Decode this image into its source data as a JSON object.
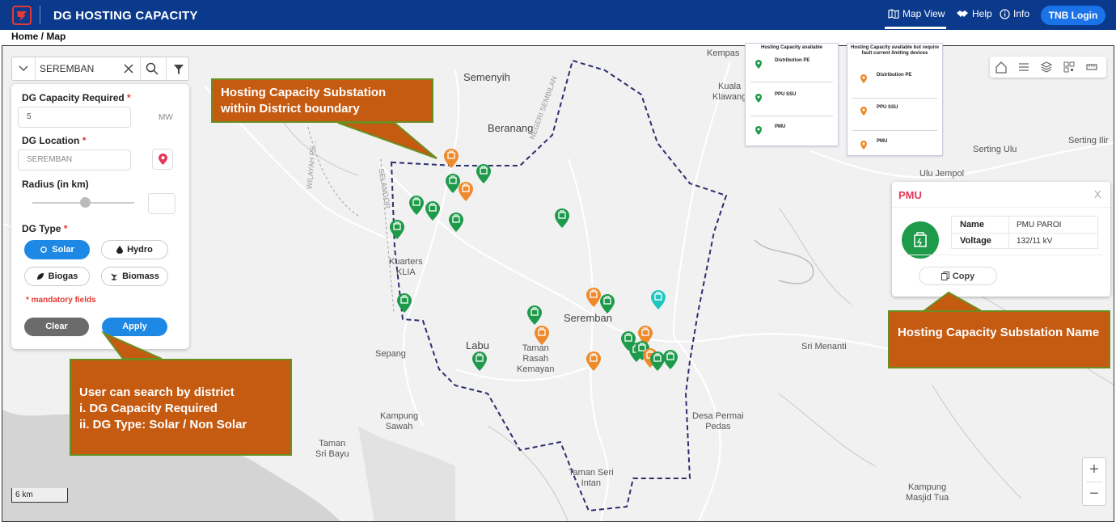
{
  "header": {
    "title": "DG HOSTING CAPACITY",
    "nav": {
      "map_view": "Map View",
      "help": "Help",
      "info": "Info",
      "login": "TNB Login"
    },
    "brand_color": "#0b3a8c"
  },
  "breadcrumb": "Home / Map",
  "search": {
    "value": "SEREMBAN"
  },
  "filter": {
    "capacity_label": "DG Capacity Required",
    "capacity_value": "5",
    "capacity_unit": "MW",
    "location_label": "DG Location",
    "location_value": "SEREMBAN",
    "radius_label": "Radius (in km)",
    "type_label": "DG Type",
    "required_mark": "*",
    "types": {
      "solar": "Solar",
      "hydro": "Hydro",
      "biogas": "Biogas",
      "biomass": "Biomass"
    },
    "mandatory_note": "* mandatory fields",
    "clear": "Clear",
    "apply": "Apply"
  },
  "legend": {
    "available": {
      "title": "Hosting Capacity available",
      "rows": [
        "Distribution PE",
        "PPU SSU",
        "PMU"
      ]
    },
    "fault_limiting": {
      "title": "Hosting Capacity available but require fault current limiting devices",
      "rows": [
        "Distribution PE",
        "PPU SSU",
        "PMU"
      ]
    }
  },
  "info_card": {
    "title": "PMU",
    "close": "X",
    "name_label": "Name",
    "name_value": "PMU PAROI",
    "voltage_label": "Voltage",
    "voltage_value": "132/11 kV",
    "copy": "Copy"
  },
  "callouts": {
    "district_boundary": "Hosting Capacity Substation within District boundary",
    "search": [
      "User can search by district",
      "i. DG Capacity Required",
      "ii. DG Type: Solar / Non Solar"
    ],
    "substation_name": "Hosting Capacity Substation Name"
  },
  "places": {
    "semenyih": "Semenyih",
    "beranang": "Beranang",
    "kempas": "Kempas",
    "kuala_klawang": "Kuala\nKlawang",
    "serting_ulu": "Serting Ulu",
    "serting_ilir": "Serting Ilir",
    "ulu_jempol": "Ulu Jempol",
    "kuarters_klia": "Kuarters\nKLIA",
    "seremban": "Seremban",
    "labu": "Labu",
    "taman_rasah": "Taman\nRasah\nKemayan",
    "sepang": "Sepang",
    "sri_menanti": "Sri Menanti",
    "kampung_sawah": "Kampung\nSawah",
    "taman_sri_bayu": "Taman\nSri Bayu",
    "desa_permai": "Desa Permai\nPedas",
    "taman_seri_intan": "Taman Seri\nIntan",
    "kampung_masjid_tua": "Kampung\nMasjid Tua",
    "negeri_sembilan": "NEGERI SEMBILAN",
    "selangor": "SELANGOR",
    "wilayah": "WILAYAH PE..."
  },
  "scale": "6 km",
  "colors": {
    "available": "#1e9a4a",
    "fault_limiting": "#ee8a2b",
    "selected": "#1fc6c0",
    "callout": "#c55a11"
  }
}
